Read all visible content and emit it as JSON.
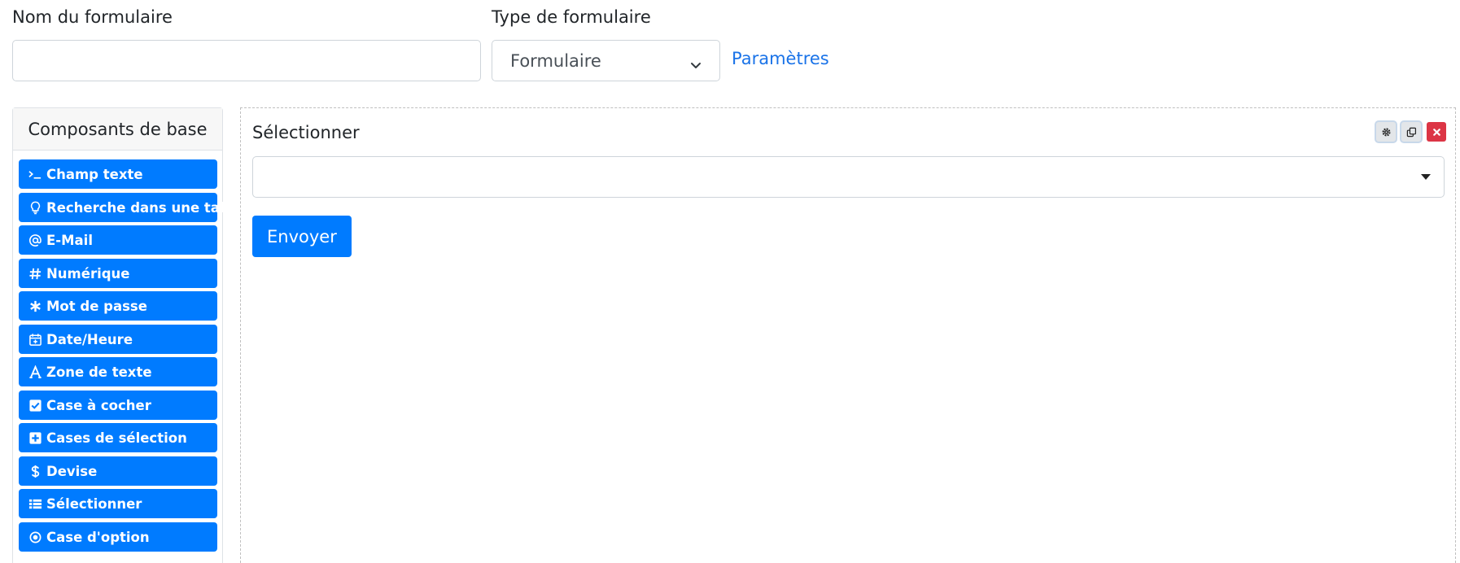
{
  "header": {
    "name_label": "Nom du formulaire",
    "name_value": "",
    "type_label": "Type de formulaire",
    "type_value": "Formulaire",
    "params_link": "Paramètres"
  },
  "sidebar": {
    "title": "Composants de base",
    "items": [
      {
        "label": "Champ texte",
        "icon": "terminal-icon"
      },
      {
        "label": "Recherche dans une table",
        "icon": "lightbulb-icon"
      },
      {
        "label": "E-Mail",
        "icon": "at-icon"
      },
      {
        "label": "Numérique",
        "icon": "hash-icon"
      },
      {
        "label": "Mot de passe",
        "icon": "asterisk-icon"
      },
      {
        "label": "Date/Heure",
        "icon": "calendar-icon"
      },
      {
        "label": "Zone de texte",
        "icon": "font-icon"
      },
      {
        "label": "Case à cocher",
        "icon": "check-square-icon"
      },
      {
        "label": "Cases de sélection",
        "icon": "plus-square-icon"
      },
      {
        "label": "Devise",
        "icon": "dollar-icon"
      },
      {
        "label": "Sélectionner",
        "icon": "list-icon"
      },
      {
        "label": "Case d'option",
        "icon": "radio-icon"
      }
    ]
  },
  "form": {
    "field_label": "Sélectionner",
    "field_value": "",
    "submit_label": "Envoyer"
  },
  "colors": {
    "primary": "#007bff",
    "danger": "#dc3545",
    "link": "#1a73e8"
  }
}
